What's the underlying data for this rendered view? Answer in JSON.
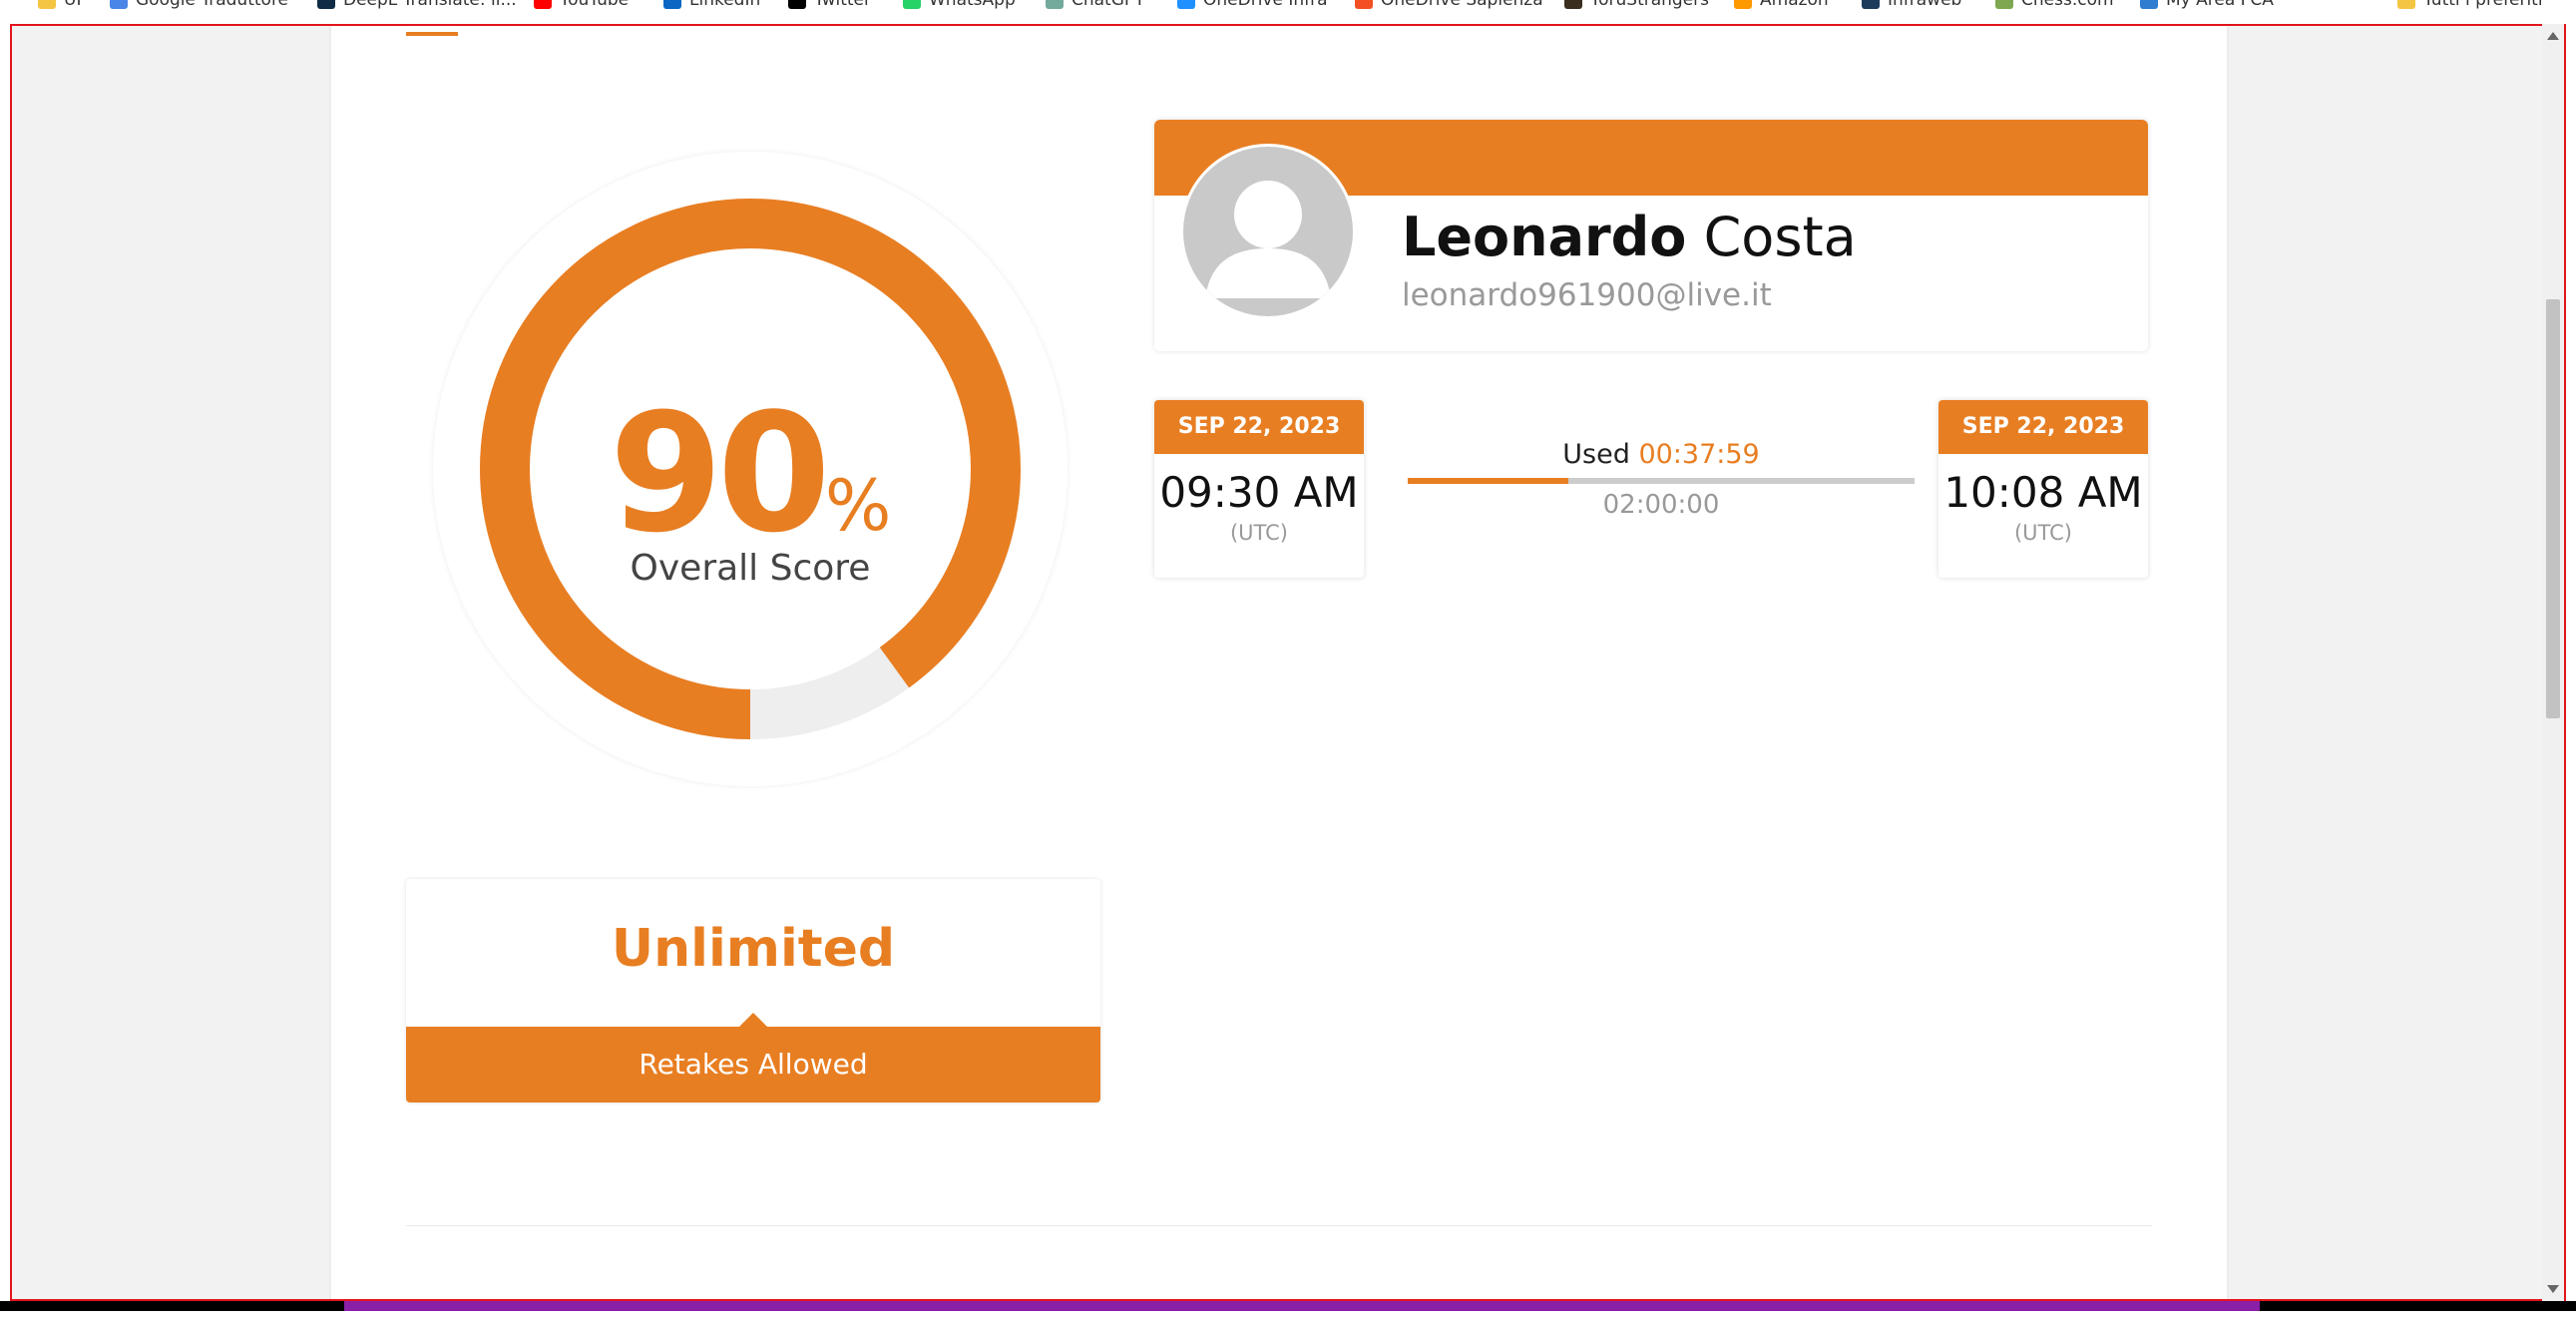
{
  "browser": {
    "bookmarks": [
      {
        "label": "UP",
        "icon": "folder-icon",
        "color": "#f4c542"
      },
      {
        "label": "Google Traduttore",
        "icon": "translate-icon",
        "color": "#4a86e8"
      },
      {
        "label": "DeepL Translate: il...",
        "icon": "deepl-icon",
        "color": "#0f2b46"
      },
      {
        "label": "YouTube",
        "icon": "youtube-icon",
        "color": "#ff0000"
      },
      {
        "label": "LinkedIn",
        "icon": "linkedin-icon",
        "color": "#0a66c2"
      },
      {
        "label": "Twitter",
        "icon": "x-icon",
        "color": "#000000"
      },
      {
        "label": "WhatsApp",
        "icon": "whatsapp-icon",
        "color": "#25d366"
      },
      {
        "label": "ChatGPT",
        "icon": "chatgpt-icon",
        "color": "#74aa9c"
      },
      {
        "label": "OneDrive Infra",
        "icon": "onedrive-icon",
        "color": "#1e90ff"
      },
      {
        "label": "OneDrive Sapienza",
        "icon": "microsoft-icon",
        "color": "#f25022"
      },
      {
        "label": "YoruStrangers",
        "icon": "bookmark-icon",
        "color": "#3a2f1f"
      },
      {
        "label": "Amazon",
        "icon": "amazon-icon",
        "color": "#ff9900"
      },
      {
        "label": "Infraweb",
        "icon": "infraweb-icon",
        "color": "#1d3b5a"
      },
      {
        "label": "Chess.com",
        "icon": "chess-icon",
        "color": "#7fa650"
      },
      {
        "label": "My Area FCA",
        "icon": "fca-icon",
        "color": "#2e7dd1"
      },
      {
        "label": "Tutti i preferiti",
        "icon": "folder-icon",
        "color": "#f4c542"
      }
    ]
  },
  "score": {
    "value": "90",
    "unit": "%",
    "label": "Overall Score",
    "fraction": 0.9
  },
  "retakes": {
    "value": "Unlimited",
    "label": "Retakes Allowed"
  },
  "profile": {
    "first_name": "Leonardo",
    "last_name": "Costa",
    "email": "leonardo961900@live.it"
  },
  "timing": {
    "start": {
      "date": "SEP 22, 2023",
      "time": "09:30 AM",
      "zone": "(UTC)"
    },
    "end": {
      "date": "SEP 22, 2023",
      "time": "10:08 AM",
      "zone": "(UTC)"
    },
    "used_label": "Used",
    "used_value": "00:37:59",
    "total": "02:00:00",
    "used_fraction": 0.3166
  },
  "colors": {
    "accent": "#e87e22",
    "track": "#eeeeee"
  }
}
